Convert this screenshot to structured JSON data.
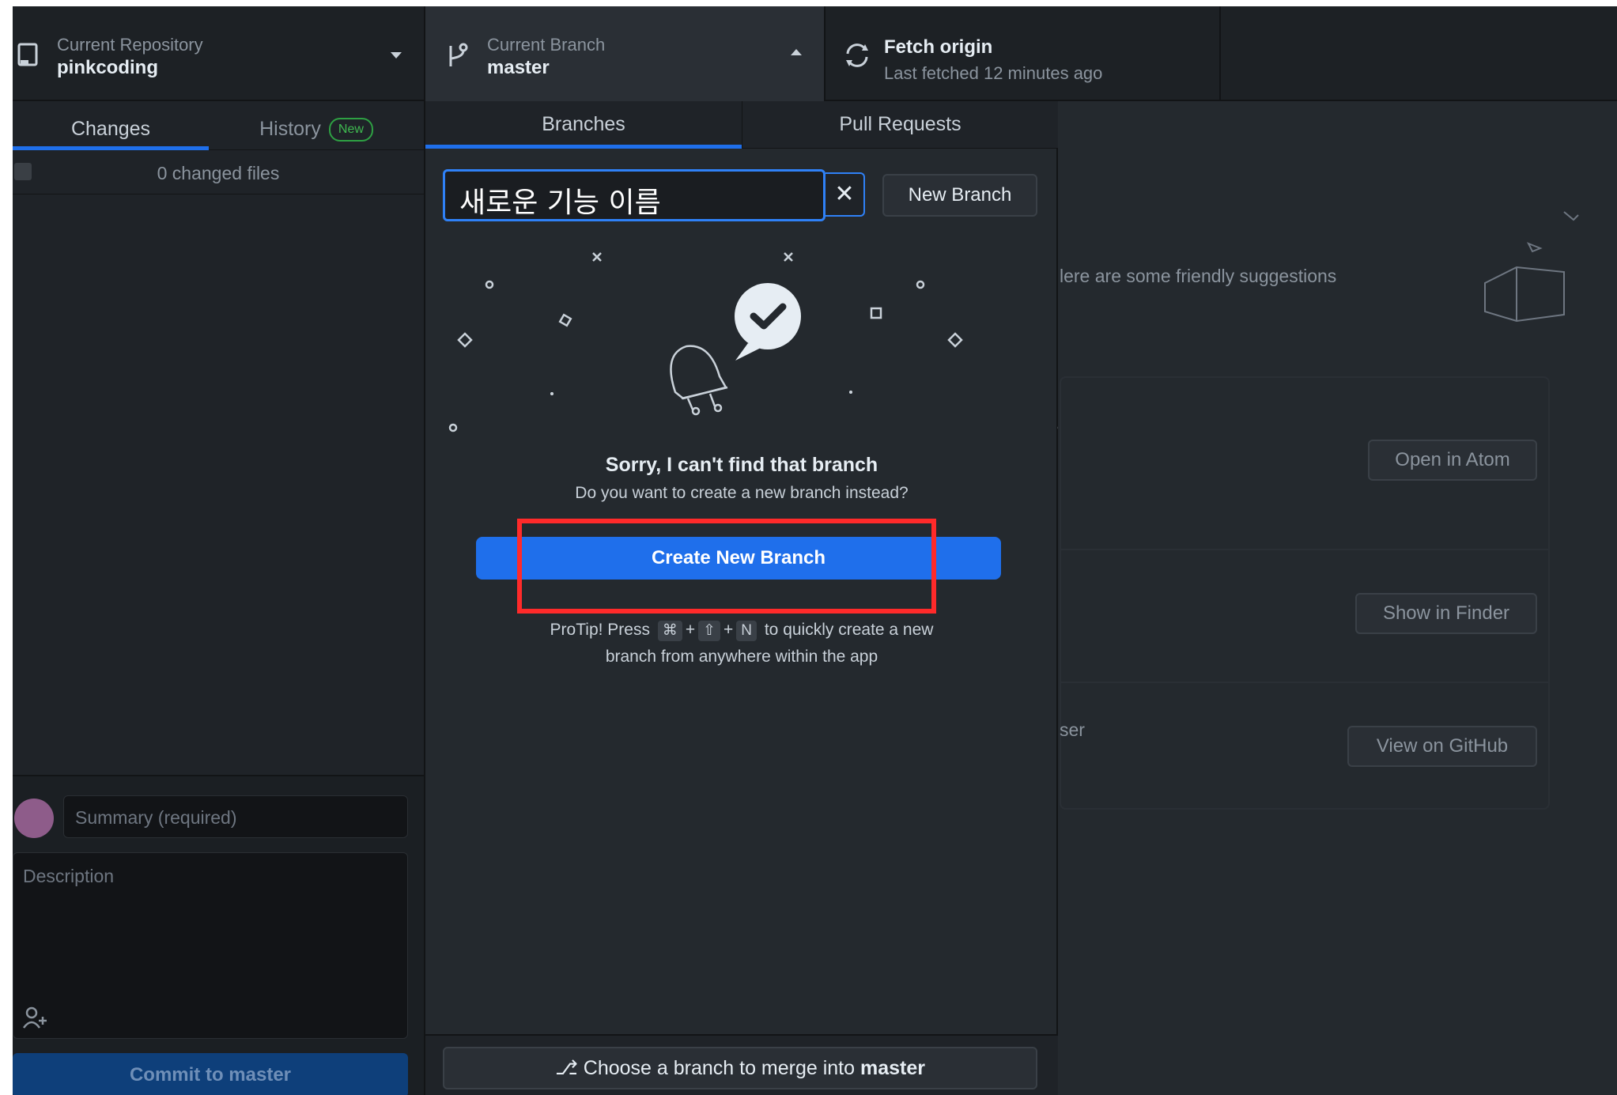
{
  "toolbar": {
    "repo_label": "Current Repository",
    "repo_value": "pinkcoding",
    "branch_label": "Current Branch",
    "branch_value": "master",
    "fetch_label": "Fetch origin",
    "fetch_sub": "Last fetched 12 minutes ago"
  },
  "sidebar": {
    "tabs": [
      {
        "label": "Changes"
      },
      {
        "label": "History",
        "badge": "New"
      }
    ],
    "changed_files": "0 changed files",
    "summary_placeholder": "Summary (required)",
    "description_placeholder": "Description",
    "commit_label": "Commit to master"
  },
  "background": {
    "suggestion_text": "lere are some friendly suggestions",
    "open_in_atom": "Open in Atom",
    "show_in_finder": "Show in Finder",
    "view_on_github": "View on GitHub",
    "partial_text": "ser"
  },
  "dropdown": {
    "tabs": [
      {
        "label": "Branches"
      },
      {
        "label": "Pull Requests"
      }
    ],
    "filter_value": "새로운 기능 이름",
    "clear_symbol": "✕",
    "new_branch_label": "New Branch",
    "sorry_text": "Sorry, I can't find that branch",
    "want_text": "Do you want to create a new branch instead?",
    "create_label": "Create New Branch",
    "protip_prefix": "ProTip! Press",
    "protip_key1": "⌘",
    "protip_plus1": "+",
    "protip_key2": "⇧",
    "protip_plus2": "+",
    "protip_key3": "N",
    "protip_suffix": "to quickly create a new",
    "protip_line2": "branch from anywhere within the app",
    "merge_prefix": "Choose a branch to merge into",
    "merge_branch": "master"
  },
  "colors": {
    "accent": "#1f6feb",
    "highlight_box": "#ff2a2a",
    "background": "#24292e"
  }
}
